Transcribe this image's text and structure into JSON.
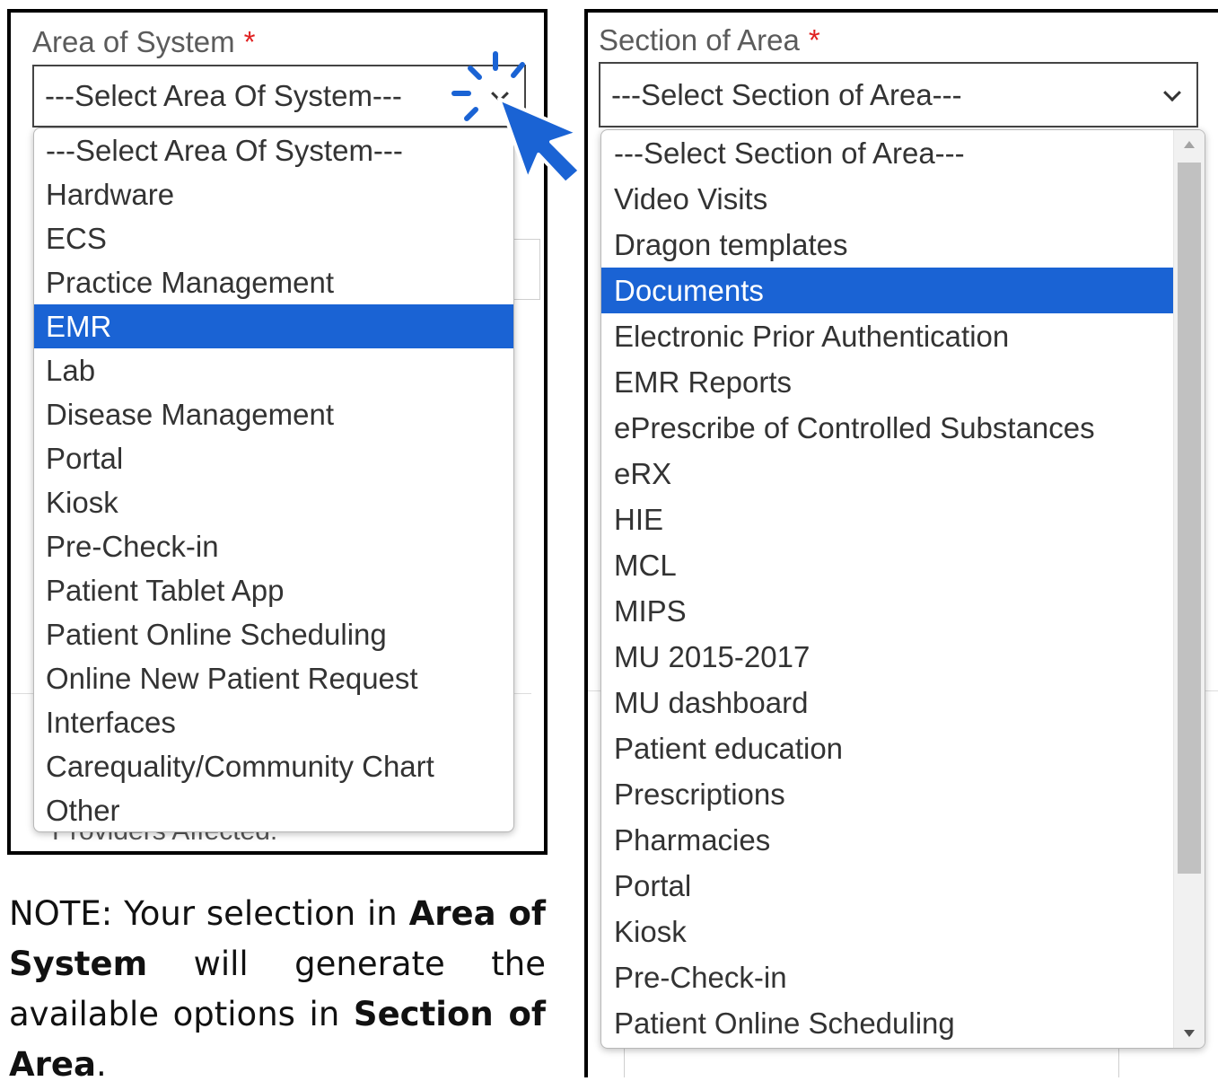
{
  "area_of_system": {
    "label": "Area of System",
    "required_marker": "*",
    "selected_value": "---Select Area Of System---",
    "options": [
      "---Select Area Of System---",
      "Hardware",
      "ECS",
      "Practice Management",
      "EMR",
      "Lab",
      "Disease Management",
      "Portal",
      "Kiosk",
      "Pre-Check-in",
      "Patient Tablet App",
      "Patient Online Scheduling",
      "Online New Patient Request",
      "Interfaces",
      "Carequality/Community Chart",
      "Other"
    ],
    "highlighted_option": "EMR",
    "background_label": "Providers Affected:"
  },
  "section_of_area": {
    "label": "Section of Area",
    "required_marker": "*",
    "selected_value": "---Select Section of Area---",
    "options": [
      "---Select Section of Area---",
      "Video Visits",
      "Dragon templates",
      "Documents",
      "Electronic Prior Authentication",
      "EMR Reports",
      "ePrescribe of Controlled Substances",
      "eRX",
      "HIE",
      "MCL",
      "MIPS",
      "MU 2015-2017",
      "MU dashboard",
      "Patient education",
      "Prescriptions",
      "Pharmacies",
      "Portal",
      "Kiosk",
      "Pre-Check-in",
      "Patient Online Scheduling"
    ],
    "highlighted_option": "Documents"
  },
  "note": {
    "prefix": "NOTE: Your selection in ",
    "bold1": "Area of System",
    "middle": " will generate the available options in ",
    "bold2": "Section of Area",
    "suffix": "."
  },
  "colors": {
    "highlight": "#1a63d4",
    "required": "#e02020",
    "cursor": "#1a63d4"
  },
  "icons": {
    "cursor": "pointer-arrow-icon",
    "click": "click-burst-icon",
    "dropdown": "chevron-down-icon"
  }
}
